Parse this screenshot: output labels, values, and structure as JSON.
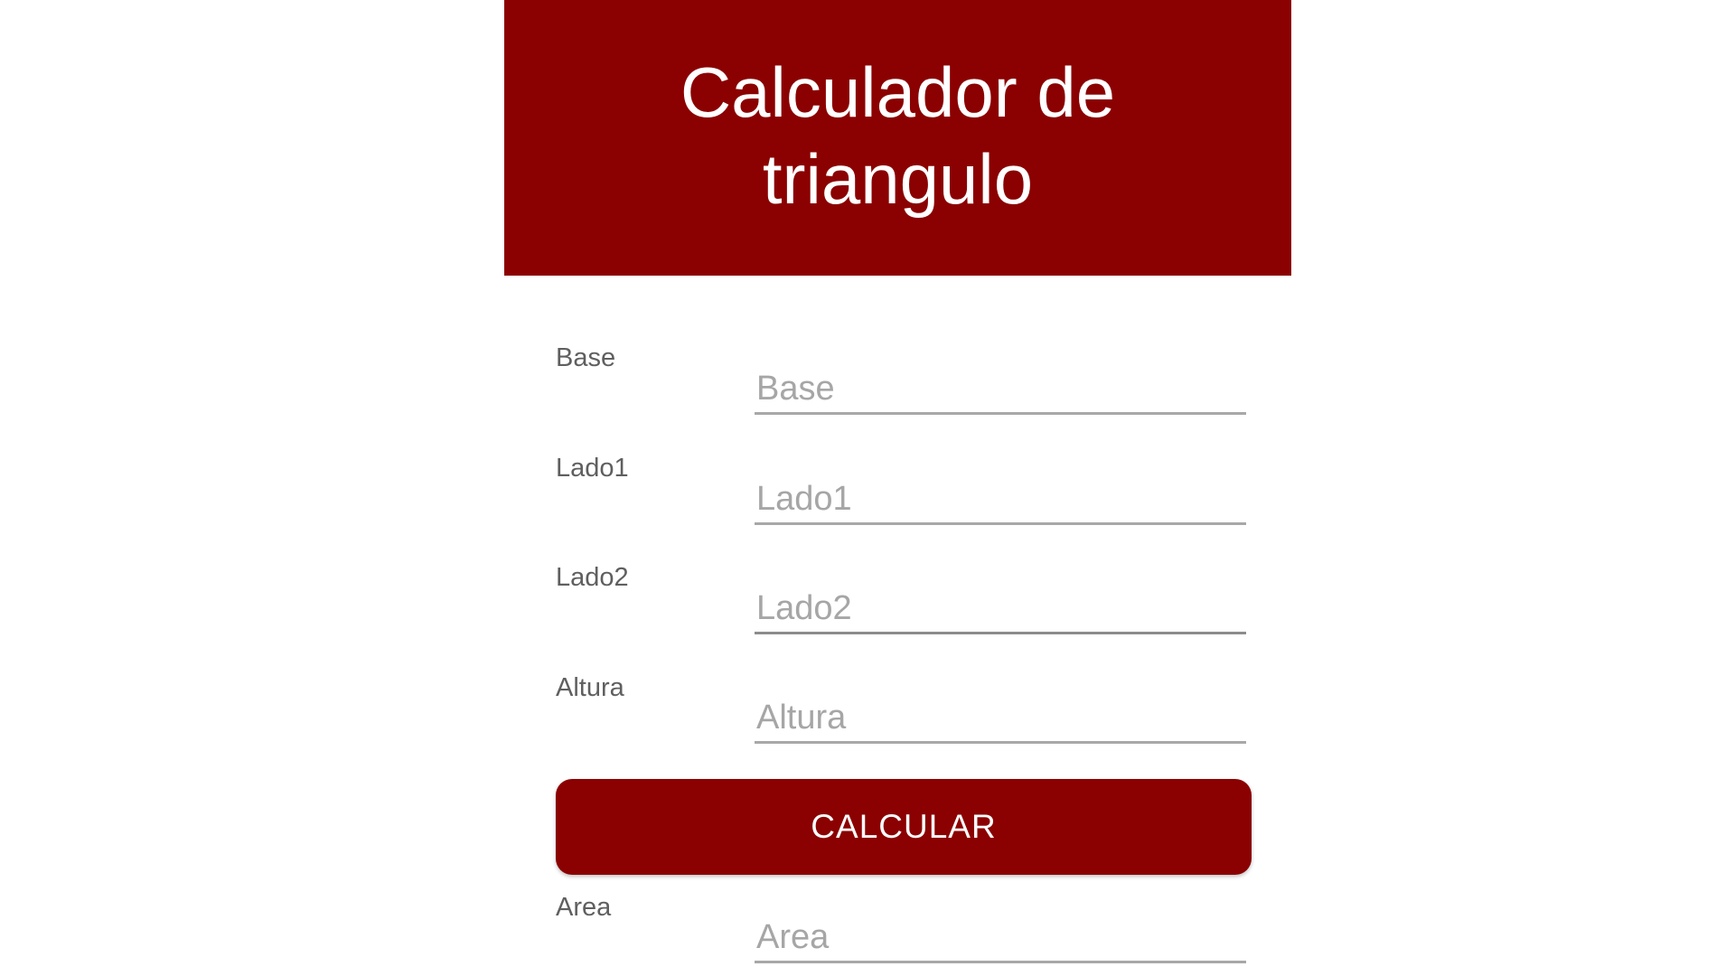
{
  "header": {
    "title": "Calculador de triangulo",
    "background": "#8b0000"
  },
  "fields": [
    {
      "label": "Base",
      "placeholder": "Base",
      "value": ""
    },
    {
      "label": "Lado1",
      "placeholder": "Lado1",
      "value": ""
    },
    {
      "label": "Lado2",
      "placeholder": "Lado2",
      "value": ""
    },
    {
      "label": "Altura",
      "placeholder": "Altura",
      "value": ""
    }
  ],
  "calculate_button": {
    "label": "CALCULAR",
    "color": "#8b0000"
  },
  "result": {
    "label": "Area",
    "placeholder": "Area",
    "value": ""
  }
}
